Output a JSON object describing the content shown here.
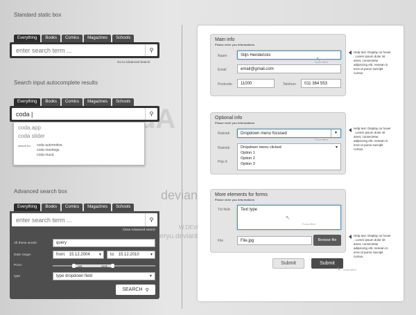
{
  "titles": {
    "standard": "Standard static box",
    "autocomplete": "Search input autocomplete results",
    "advanced": "Advanced search box"
  },
  "tabs": [
    "Everything",
    "Books",
    "Comics",
    "Magazines",
    "Schools"
  ],
  "standard": {
    "placeholder": "enter search term ...",
    "adv_link": "Go to Advanced Search"
  },
  "autocomplete": {
    "value": "coda |",
    "results": [
      "coda.app",
      "coda slider"
    ],
    "search_for_label": "search for:",
    "suggestions": [
      "coda automotive",
      "coda meetings",
      "coda music"
    ]
  },
  "advanced": {
    "placeholder": "enter search term ...",
    "close_link": "Close Advanced search",
    "all_words_label": "All these words:",
    "all_words_value": "query",
    "date_label": "Date range:",
    "from_label": "from:",
    "from_value": "15.12.2004",
    "to_label": "to:",
    "to_value": "15.12.2010",
    "price_label": "Price:",
    "price_min": "40$",
    "price_max": "100$",
    "price_min_frac": 0.2,
    "price_max_frac": 0.58,
    "type_label": "type",
    "type_value": "type dropdown field",
    "search_button": "SEARCH"
  },
  "main_info": {
    "title": "Main info",
    "subtitle": "Please enter you informations",
    "name_label": "Naam",
    "name_value": "Stijn Henderickx",
    "email_label": "Email",
    "email_value": "email@gmail.com",
    "postcode_label": "Postcode",
    "postcode_value": "11000",
    "telefoon_label": "Telefoon",
    "telefoon_value": "011 364 553",
    "hover_note": "Hover effect"
  },
  "optional_info": {
    "title": "Optional info",
    "subtitle": "Please enter you informations",
    "rubriek_label": "Rubriek",
    "dropdown_focused": "Dropdown menu focused",
    "rubriek2_label": "Rubriek",
    "dropdown_clicked": "Dropdown menu clicked",
    "options": [
      "Option 1",
      "Option 2",
      "Option 3"
    ],
    "prijs_label": "Prijs €",
    "focus_note": "Focus effect"
  },
  "more": {
    "title": "More elements for forms",
    "subtitle": "Please enter you informations",
    "txt_label": "Txt field",
    "textarea_value": "Text type",
    "file_label": "File",
    "file_value": "File.jpg",
    "browse": "Browse file",
    "focus_note": "Focus effect"
  },
  "buttons": {
    "submit1": "Submit",
    "submit2": "Submit",
    "hover_note": "Hover effect"
  },
  "help": {
    "h1": "Help text. Display on hover . Lorem ipsum dolor sit amet, consectetur adipiscing elit. Aenean in eros ut purus suscipit cursus.",
    "h2": "Help text. Display on hover . Lorem ipsum dolor sit amet, consectetur adipiscing elit. Aenean in eros ut purus suscipit cursus.",
    "h3": "Help text. Display on hover . Lorem ipsum dolor sit amet, consectetur adipiscing elit. Aenean in eros ut purus suscipit cursus."
  },
  "watermark": {
    "brand": "deviantART",
    "url1": "W.DEVIANTART.COM",
    "url2": "(c) sniperyu.deviantart.com"
  }
}
